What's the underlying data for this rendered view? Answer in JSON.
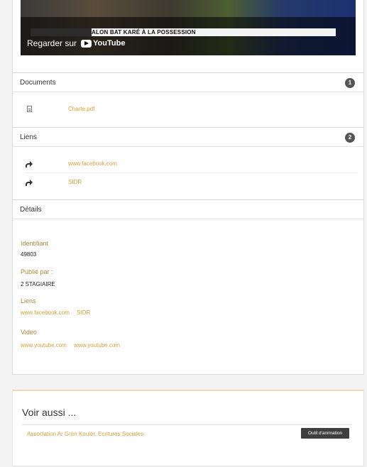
{
  "video": {
    "banner_left": "",
    "banner_text": "ALON BAT KARÉ À LA POSSESSION",
    "watch_label": "Regarder sur",
    "platform": "YouTube"
  },
  "documents": {
    "title": "Documents",
    "count": "1",
    "items": [
      {
        "label": "Charte.pdf",
        "icon": "file-icon"
      }
    ]
  },
  "links": {
    "title": "Liens",
    "count": "2",
    "items": [
      {
        "label": "www.facebook.com",
        "icon": "share-icon"
      },
      {
        "label": "SIDR",
        "icon": "share-icon"
      }
    ]
  },
  "details": {
    "title": "Détails",
    "identifier_label": "Identifiant",
    "identifier_value": "49803",
    "published_label": "Publié par :",
    "published_value": "2 STAGIAIRE",
    "links_label": "Liens",
    "links": [
      "www.facebook.com",
      "SIDR"
    ],
    "video_label": "Video",
    "videos": [
      "www.youtube.com",
      "www.youtube.com"
    ]
  },
  "see_also": {
    "title": "Voir aussi ...",
    "item_label": "Association Ar Grèn Koulèr, Ecritures Sociales",
    "tag": "Outil d'animation"
  }
}
